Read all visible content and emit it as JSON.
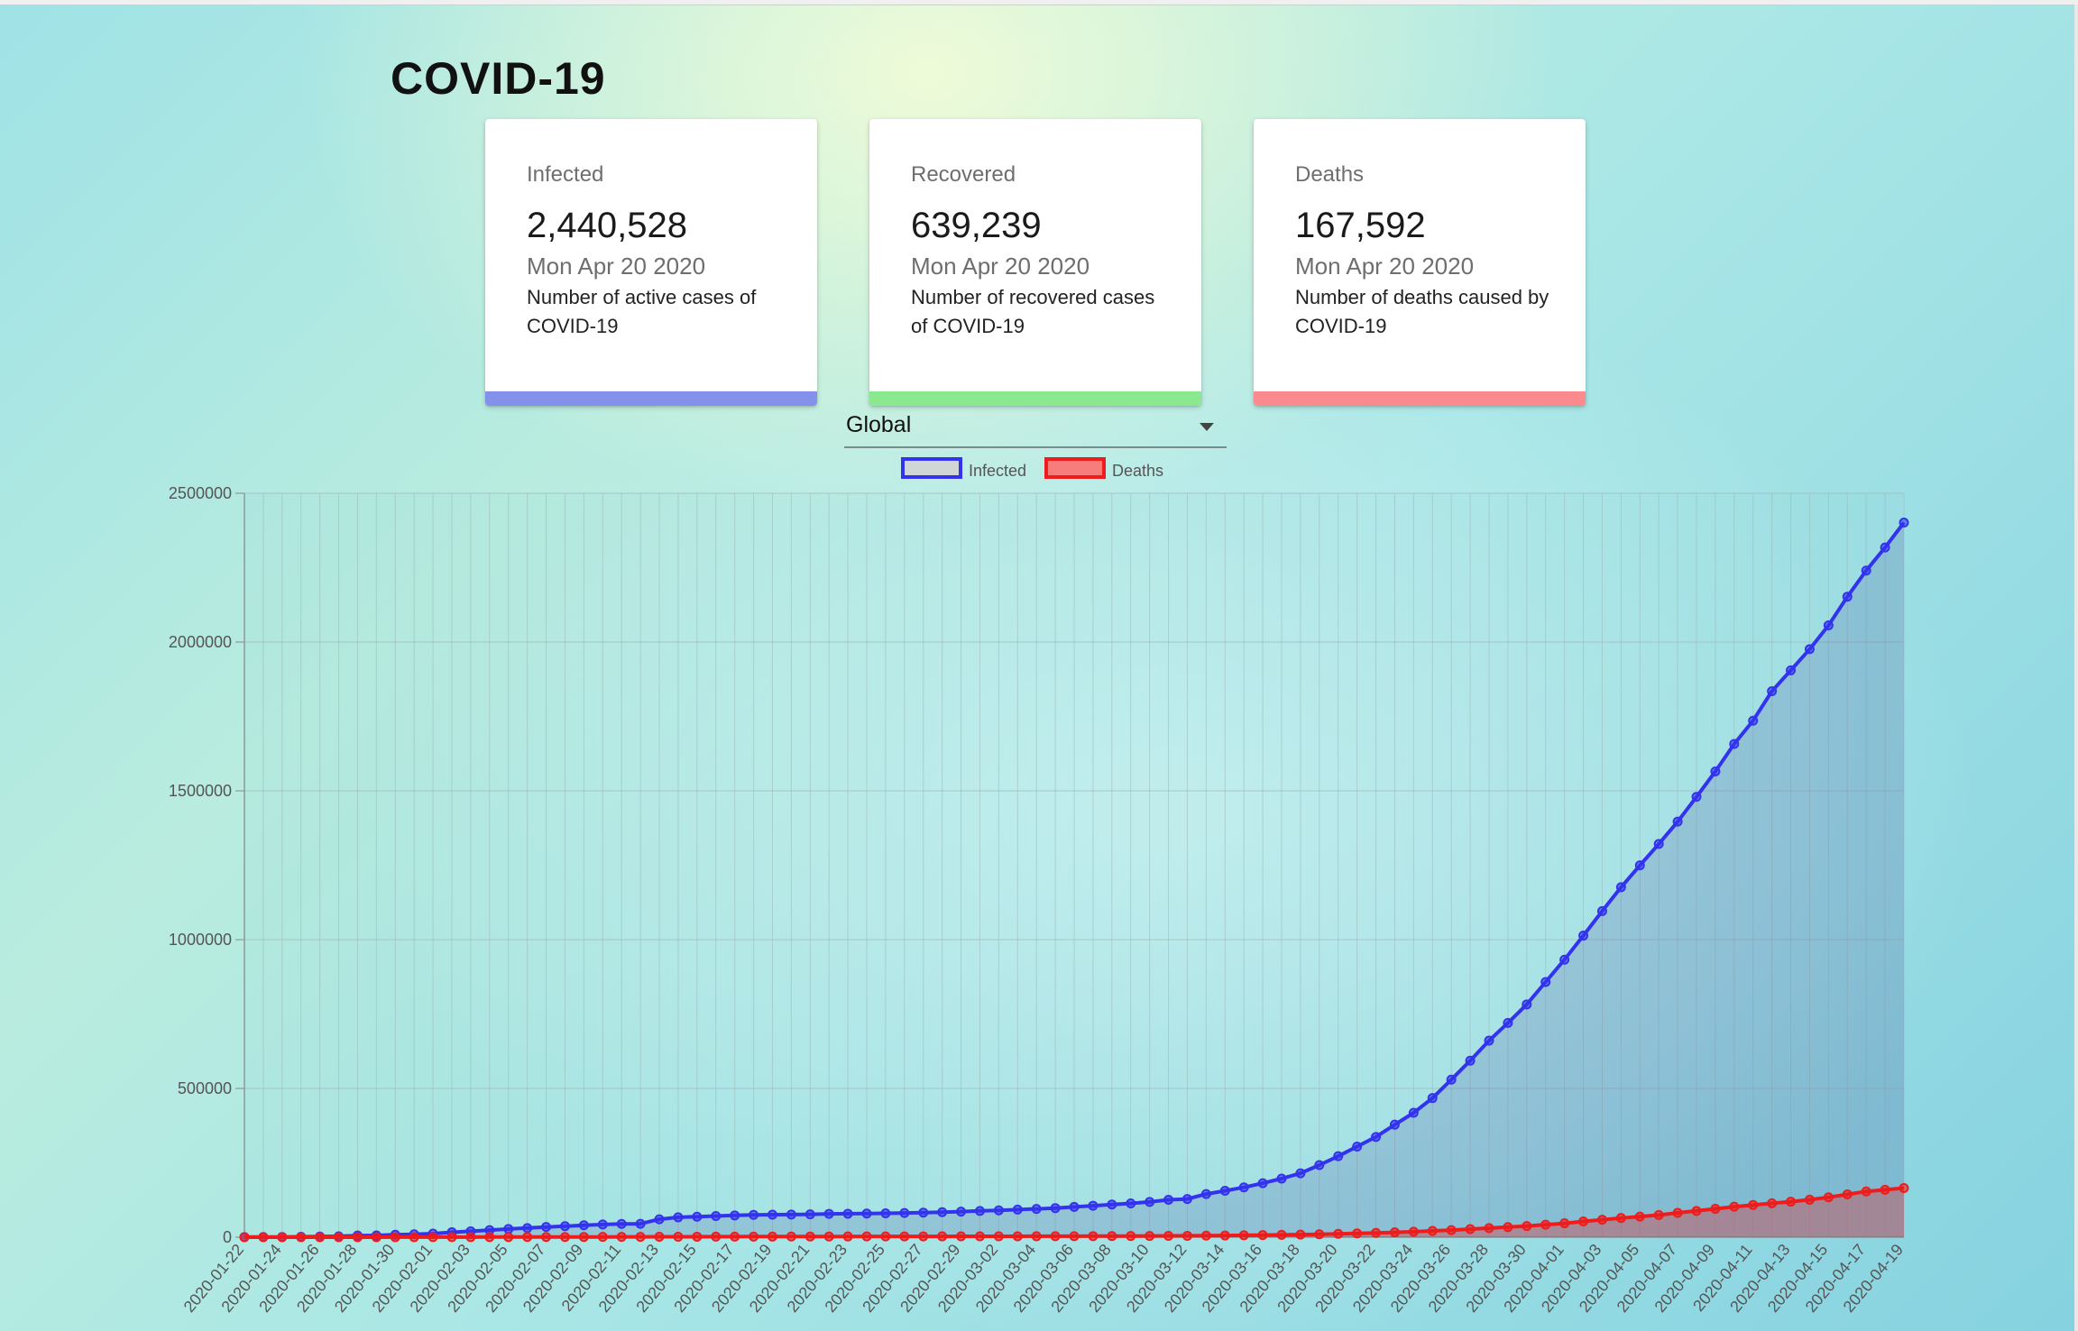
{
  "page": {
    "title": "COVID-19"
  },
  "cards": {
    "infected": {
      "label": "Infected",
      "value": "2,440,528",
      "date": "Mon Apr 20 2020",
      "description": "Number of active cases of COVID-19",
      "accent": "#8391ea"
    },
    "recovered": {
      "label": "Recovered",
      "value": "639,239",
      "date": "Mon Apr 20 2020",
      "description": "Number of recovered cases of COVID-19",
      "accent": "#8ae88f"
    },
    "deaths": {
      "label": "Deaths",
      "value": "167,592",
      "date": "Mon Apr 20 2020",
      "description": "Number of deaths caused by COVID-19",
      "accent": "#fb8a8e"
    }
  },
  "country_select": {
    "selected": "Global"
  },
  "colors": {
    "infected_line": "#3333ee",
    "deaths_line": "#ee1c1c",
    "grid": "#9cb8b8"
  },
  "chart_data": {
    "type": "line",
    "start_date": "2020-01-22",
    "label_every": 2,
    "x": [
      "2020-01-22",
      "2020-01-23",
      "2020-01-24",
      "2020-01-25",
      "2020-01-26",
      "2020-01-27",
      "2020-01-28",
      "2020-01-29",
      "2020-01-30",
      "2020-01-31",
      "2020-02-01",
      "2020-02-02",
      "2020-02-03",
      "2020-02-04",
      "2020-02-05",
      "2020-02-06",
      "2020-02-07",
      "2020-02-08",
      "2020-02-09",
      "2020-02-10",
      "2020-02-11",
      "2020-02-12",
      "2020-02-13",
      "2020-02-14",
      "2020-02-15",
      "2020-02-16",
      "2020-02-17",
      "2020-02-18",
      "2020-02-19",
      "2020-02-20",
      "2020-02-21",
      "2020-02-22",
      "2020-02-23",
      "2020-02-24",
      "2020-02-25",
      "2020-02-26",
      "2020-02-27",
      "2020-02-28",
      "2020-02-29",
      "2020-03-01",
      "2020-03-02",
      "2020-03-03",
      "2020-03-04",
      "2020-03-05",
      "2020-03-06",
      "2020-03-07",
      "2020-03-08",
      "2020-03-09",
      "2020-03-10",
      "2020-03-11",
      "2020-03-12",
      "2020-03-13",
      "2020-03-14",
      "2020-03-15",
      "2020-03-16",
      "2020-03-17",
      "2020-03-18",
      "2020-03-19",
      "2020-03-20",
      "2020-03-21",
      "2020-03-22",
      "2020-03-23",
      "2020-03-24",
      "2020-03-25",
      "2020-03-26",
      "2020-03-27",
      "2020-03-28",
      "2020-03-29",
      "2020-03-30",
      "2020-03-31",
      "2020-04-01",
      "2020-04-02",
      "2020-04-03",
      "2020-04-04",
      "2020-04-05",
      "2020-04-06",
      "2020-04-07",
      "2020-04-08",
      "2020-04-09",
      "2020-04-10",
      "2020-04-11",
      "2020-04-12",
      "2020-04-13",
      "2020-04-14",
      "2020-04-15",
      "2020-04-16",
      "2020-04-17",
      "2020-04-18",
      "2020-04-19"
    ],
    "series": [
      {
        "name": "Infected",
        "values": [
          555,
          654,
          941,
          1434,
          2118,
          2927,
          5578,
          6167,
          8235,
          9927,
          12038,
          16787,
          19881,
          23892,
          27635,
          30794,
          34391,
          37120,
          40150,
          42762,
          44802,
          45221,
          60368,
          66885,
          69030,
          71224,
          73258,
          75136,
          75639,
          76197,
          76819,
          78572,
          78958,
          79561,
          80406,
          81388,
          82746,
          84112,
          86011,
          88369,
          90306,
          92840,
          95120,
          97886,
          101801,
          105847,
          109821,
          113590,
          118620,
          125875,
          128352,
          145205,
          156101,
          167454,
          181574,
          197102,
          214821,
          242570,
          272208,
          304507,
          336953,
          378235,
          418045,
          467653,
          529591,
          593291,
          660706,
          720117,
          782365,
          857487,
          932605,
          1013466,
          1095917,
          1176060,
          1249754,
          1321481,
          1396476,
          1479804,
          1565278,
          1657526,
          1735650,
          1834721,
          1904838,
          1976191,
          2056054,
          2152437,
          2240191,
          2317759,
          2401379
        ]
      },
      {
        "name": "Deaths",
        "values": [
          17,
          18,
          26,
          42,
          56,
          82,
          131,
          133,
          171,
          213,
          259,
          362,
          426,
          492,
          564,
          634,
          719,
          806,
          906,
          1013,
          1113,
          1118,
          1371,
          1523,
          1666,
          1770,
          1868,
          2007,
          2122,
          2247,
          2251,
          2458,
          2469,
          2629,
          2708,
          2770,
          2814,
          2872,
          2941,
          2996,
          3085,
          3160,
          3254,
          3348,
          3460,
          3558,
          3802,
          3988,
          4262,
          4615,
          4720,
          5404,
          5819,
          6440,
          7126,
          7905,
          8733,
          9867,
          11299,
          12973,
          14623,
          16497,
          18615,
          21181,
          23970,
          27198,
          30652,
          33925,
          37582,
          42107,
          46809,
          52983,
          58787,
          64606,
          69374,
          74565,
          81865,
          88338,
          95455,
          102525,
          108503,
          114090,
          119482,
          125984,
          134176,
          143800,
          153822,
          159510,
          165044
        ]
      }
    ],
    "ylim": [
      0,
      2500000
    ],
    "yticks": [
      0,
      500000,
      1000000,
      1500000,
      2000000,
      2500000
    ],
    "grid": true,
    "legend": "top"
  }
}
